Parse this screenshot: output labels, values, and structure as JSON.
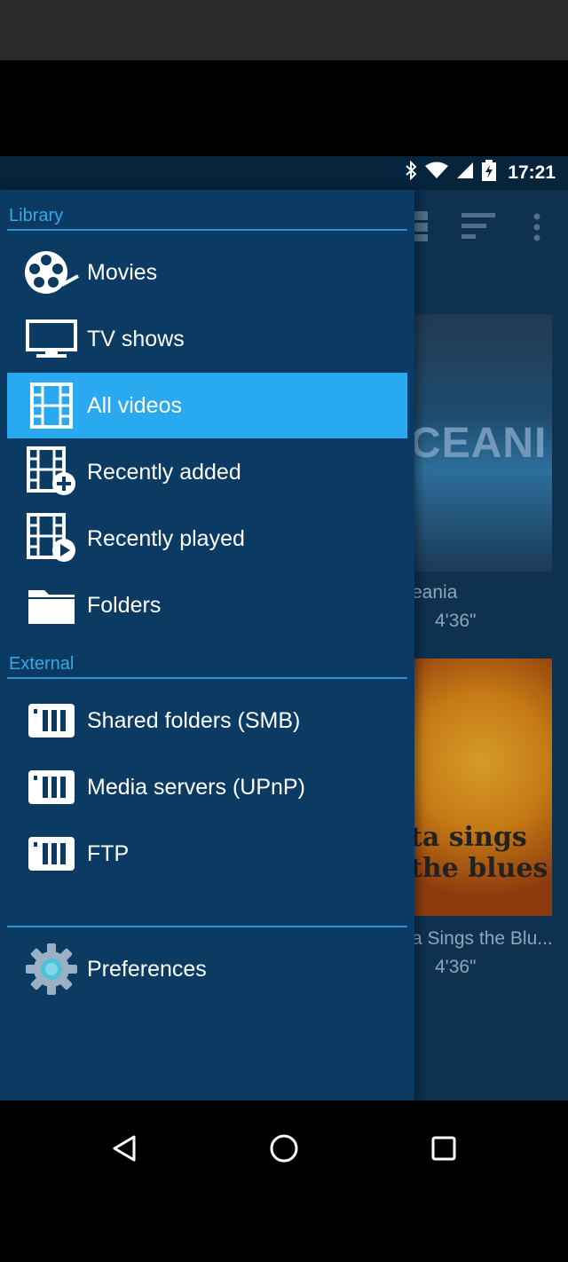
{
  "status": {
    "time": "17:21",
    "icons": [
      "bluetooth-icon",
      "wifi-icon",
      "signal-icon",
      "battery-charging-icon"
    ]
  },
  "background": {
    "poster1_text": "CEANI",
    "caption1": "eania",
    "duration1": "4'36\"",
    "poster2_text": "ta sings the blues",
    "caption2": "a Sings the Blu...",
    "duration2": "4'36\""
  },
  "drawer": {
    "library_title": "Library",
    "library_items": [
      {
        "label": "Movies",
        "icon": "film-reel-icon"
      },
      {
        "label": "TV shows",
        "icon": "tv-icon"
      },
      {
        "label": "All videos",
        "icon": "film-strip-icon"
      },
      {
        "label": "Recently added",
        "icon": "film-add-icon"
      },
      {
        "label": "Recently played",
        "icon": "film-play-icon"
      },
      {
        "label": "Folders",
        "icon": "folder-icon"
      }
    ],
    "external_title": "External",
    "external_items": [
      {
        "label": "Shared folders (SMB)",
        "icon": "network-drive-icon"
      },
      {
        "label": "Media servers (UPnP)",
        "icon": "network-drive-icon"
      },
      {
        "label": "FTP",
        "icon": "network-drive-icon"
      }
    ],
    "preferences_label": "Preferences"
  },
  "colors": {
    "accent": "#29a9f0",
    "drawer_bg": "#0b3a62",
    "section_text": "#3aa6e6"
  }
}
